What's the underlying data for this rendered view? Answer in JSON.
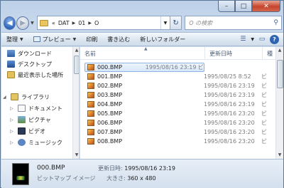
{
  "address": {
    "crumbs": [
      "«",
      "DAT",
      "01",
      "O"
    ],
    "search_placeholder": "O の検索"
  },
  "commandbar": {
    "organize": "整理",
    "preview": "プレビュー",
    "print": "印刷",
    "burn": "書き込む",
    "new_folder": "新しいフォルダー"
  },
  "nav": {
    "items": [
      {
        "label": "ダウンロード",
        "icon": "download-folder-icon"
      },
      {
        "label": "デスクトップ",
        "icon": "desktop-icon"
      },
      {
        "label": "最近表示した場所",
        "icon": "recent-places-icon"
      },
      {
        "label": "ライブラリ",
        "icon": "libraries-icon"
      },
      {
        "label": "ドキュメント",
        "icon": "documents-icon"
      },
      {
        "label": "ピクチャ",
        "icon": "pictures-icon"
      },
      {
        "label": "ビデオ",
        "icon": "videos-icon"
      },
      {
        "label": "ミュージック",
        "icon": "music-icon"
      }
    ]
  },
  "columns": {
    "name": "名前",
    "date": "更新日時",
    "type": "種"
  },
  "files": [
    {
      "name": "000.BMP",
      "date": "1995/08/16 23:19",
      "type": "ビ",
      "selected": true
    },
    {
      "name": "001.BMP",
      "date": "1995/08/25 8:52",
      "type": "ビ"
    },
    {
      "name": "002.BMP",
      "date": "1995/08/16 23:19",
      "type": "ビ"
    },
    {
      "name": "003.BMP",
      "date": "1995/08/16 23:19",
      "type": "ビ"
    },
    {
      "name": "004.BMP",
      "date": "1995/08/16 23:19",
      "type": "ビ"
    },
    {
      "name": "005.BMP",
      "date": "1995/08/16 23:20",
      "type": "ビ"
    },
    {
      "name": "006.BMP",
      "date": "1995/08/16 23:20",
      "type": "ビ"
    },
    {
      "name": "007.BMP",
      "date": "1995/08/16 23:20",
      "type": "ビ"
    },
    {
      "name": "008.BMP",
      "date": "1995/08/16 23:20",
      "type": "ビ"
    }
  ],
  "details": {
    "name": "000.BMP",
    "type": "ビットマップ イメージ",
    "date_label": "更新日時:",
    "date_value": "1995/08/16 23:19",
    "size_label": "大きさ:",
    "size_value": "360 x 480"
  }
}
